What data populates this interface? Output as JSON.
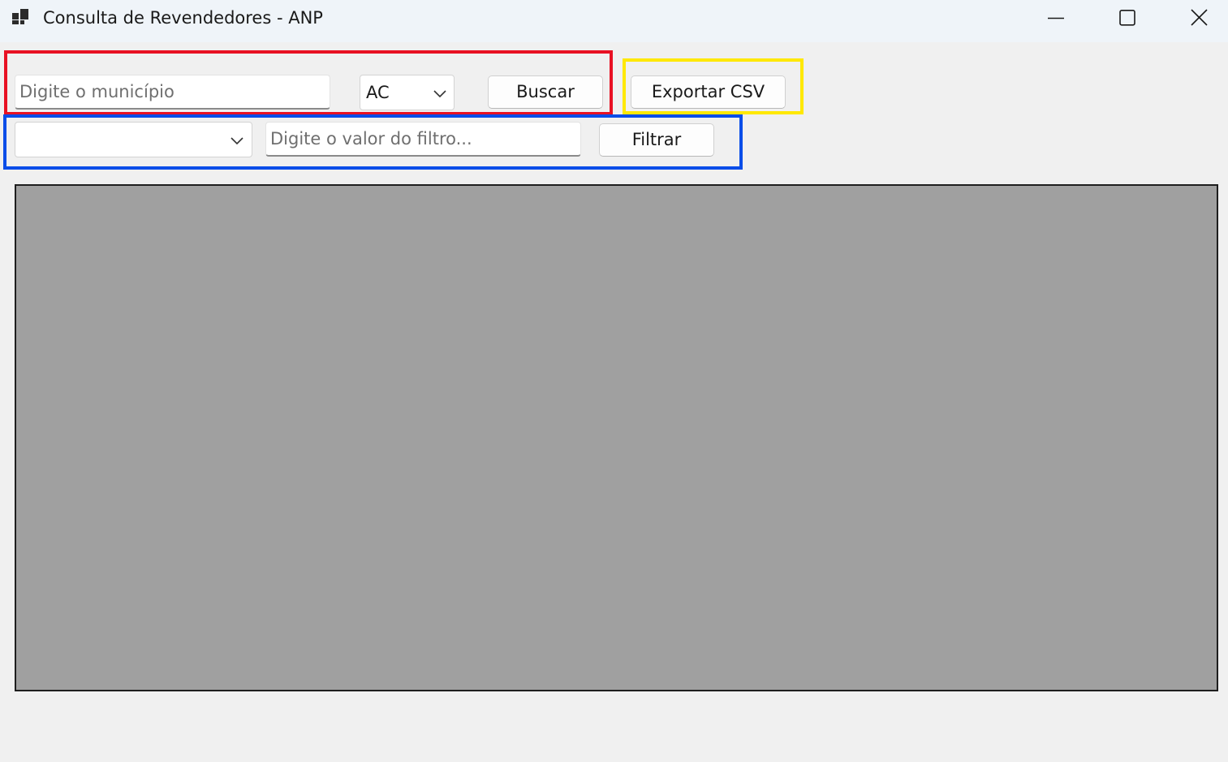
{
  "window": {
    "title": "Consulta de Revendedores - ANP",
    "app_icon": "winforms-app-icon",
    "controls": {
      "minimize_icon": "minimize-icon",
      "maximize_icon": "maximize-icon",
      "close_icon": "close-icon"
    }
  },
  "search": {
    "municipio_placeholder": "Digite o município",
    "municipio_value": "",
    "uf_selected": "AC",
    "buscar_label": "Buscar"
  },
  "export": {
    "exportar_label": "Exportar CSV"
  },
  "filter": {
    "campo_selected": "",
    "valor_placeholder": "Digite o valor do filtro...",
    "valor_value": "",
    "filtrar_label": "Filtrar"
  },
  "highlights": {
    "search_group_color": "#e81123",
    "export_group_color": "#ffe800",
    "filter_group_color": "#0a4de8"
  },
  "colors": {
    "titlebar_bg": "#eff4f9",
    "window_bg": "#f0f0f0",
    "grid_bg": "#a0a0a0"
  }
}
